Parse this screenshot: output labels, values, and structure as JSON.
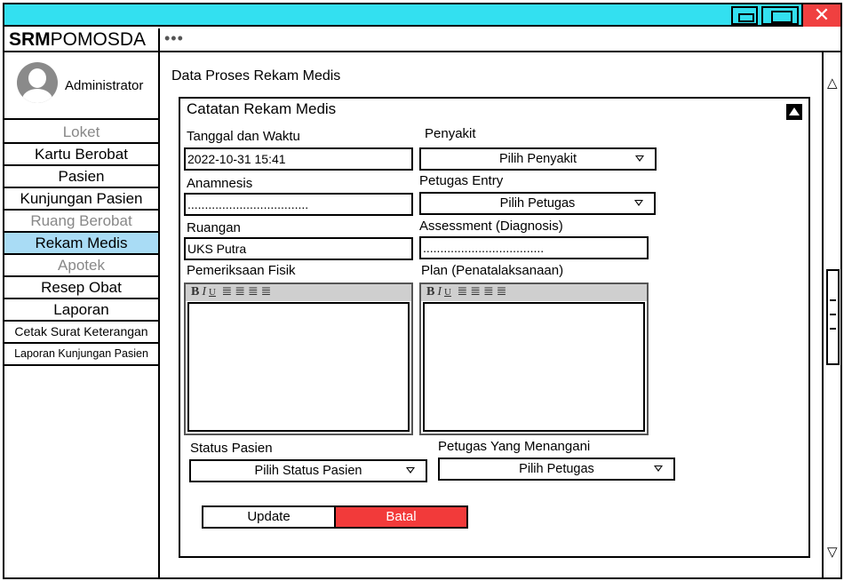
{
  "app": {
    "brand_bold": "SRM",
    "brand_rest": "POMOSDA",
    "menu_dots": "•••",
    "close_glyph": "✕"
  },
  "user": {
    "name": "Administrator"
  },
  "sidebar": {
    "items": [
      {
        "label": "Loket",
        "type": "header"
      },
      {
        "label": "Kartu Berobat",
        "type": "link"
      },
      {
        "label": "Pasien",
        "type": "link"
      },
      {
        "label": "Kunjungan Pasien",
        "type": "link"
      },
      {
        "label": "Ruang Berobat",
        "type": "header"
      },
      {
        "label": "Rekam Medis",
        "type": "active"
      },
      {
        "label": "Apotek",
        "type": "header"
      },
      {
        "label": "Resep Obat",
        "type": "link"
      },
      {
        "label": "Laporan",
        "type": "link"
      },
      {
        "label": "Cetak Surat Keterangan",
        "type": "link"
      },
      {
        "label": "Laporan Kunjungan Pasien",
        "type": "link"
      }
    ]
  },
  "main": {
    "page_title": "Data Proses Rekam Medis",
    "panel_title": "Catatan Rekam Medis"
  },
  "form": {
    "tanggal": {
      "label": "Tanggal dan Waktu",
      "value": "2022-10-31 15:41"
    },
    "penyakit": {
      "label": "Penyakit",
      "value": "Pilih Penyakit"
    },
    "anamnesis": {
      "label": "Anamnesis",
      "value": "..................................."
    },
    "petugas_entry": {
      "label": "Petugas Entry",
      "value": "Pilih Petugas"
    },
    "ruangan": {
      "label": "Ruangan",
      "value": "UKS Putra"
    },
    "assessment": {
      "label": "Assessment (Diagnosis)",
      "value": "..................................."
    },
    "pemeriksaan": {
      "label": "Pemeriksaan Fisik"
    },
    "plan": {
      "label": "Plan (Penatalaksanaan)"
    },
    "status_pasien": {
      "label": "Status Pasien",
      "value": "Pilih Status Pasien"
    },
    "petugas_menangani": {
      "label": "Petugas Yang Menangani",
      "value": "Pilih Petugas"
    },
    "editor_toolbar": {
      "bold": "B",
      "italic": "I",
      "underline": "U",
      "align_left": "≣",
      "align_center": "≣",
      "align_right": "≣",
      "justify": "≣"
    },
    "buttons": {
      "update": "Update",
      "batal": "Batal"
    }
  },
  "scroll": {
    "up_glyph": "△",
    "down_glyph": "▽"
  },
  "colors": {
    "titlebar": "#33e0f0",
    "close": "#f04040",
    "active_nav": "#a9dcf5",
    "cancel": "#f23a3a"
  }
}
